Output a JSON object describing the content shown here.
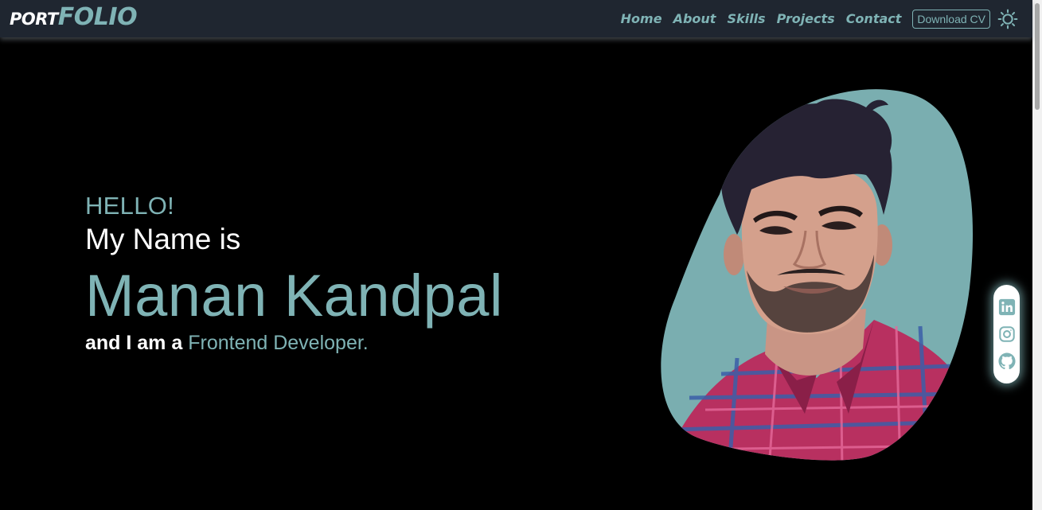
{
  "header": {
    "logo": {
      "part1": "PORT",
      "part2": "FOLIO"
    },
    "nav": [
      "Home",
      "About",
      "Skills",
      "Projects",
      "Contact"
    ],
    "cv_button": "Download CV",
    "theme_icon": "gear-icon"
  },
  "hero": {
    "greeting": "HELLO!",
    "intro": "My Name is",
    "name": "Manan Kandpal",
    "role_lead": "and I am a ",
    "role": "Frontend Developer."
  },
  "social": [
    "linkedin-icon",
    "instagram-icon",
    "github-icon"
  ],
  "colors": {
    "accent": "#7fb3b5",
    "nav_bg": "#1f2630",
    "background": "#000000"
  }
}
